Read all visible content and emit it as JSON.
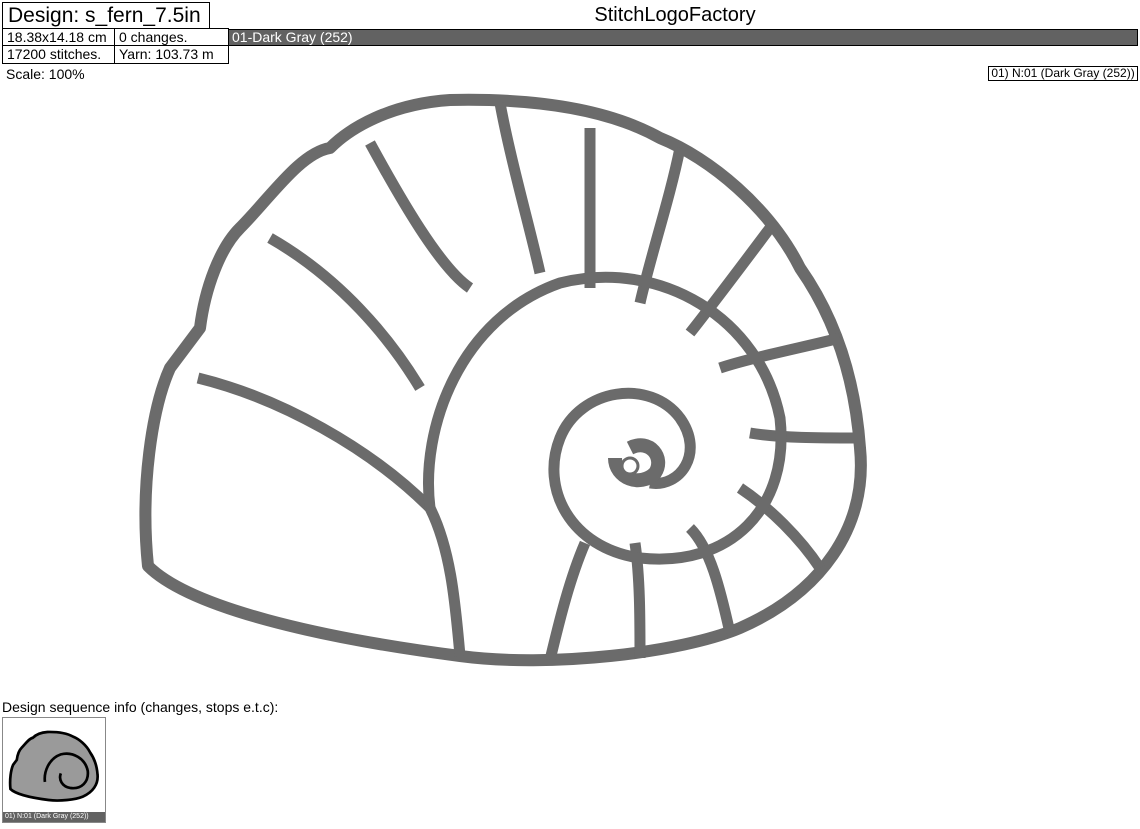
{
  "header": {
    "design_title": "Design: s_fern_7.5in",
    "app_title": "StitchLogoFactory",
    "dimensions": "18.38x14.18 cm",
    "changes": "0 changes.",
    "stitches": "17200 stitches.",
    "yarn": "Yarn: 103.73 m"
  },
  "color_bar": {
    "label": "01-Dark Gray (252)",
    "color": "#626262"
  },
  "scale": "Scale: 100%",
  "legend": {
    "label": "01) N:01 (Dark Gray (252))"
  },
  "design": {
    "subject": "nautilus-shell-embroidery",
    "thread_color": "#6b6b6b",
    "fill_color": "#ffffff"
  },
  "sequence": {
    "label": "Design sequence info (changes, stops e.t.c):",
    "items": [
      {
        "caption": "01) N:01 (Dark Gray (252))"
      }
    ]
  }
}
